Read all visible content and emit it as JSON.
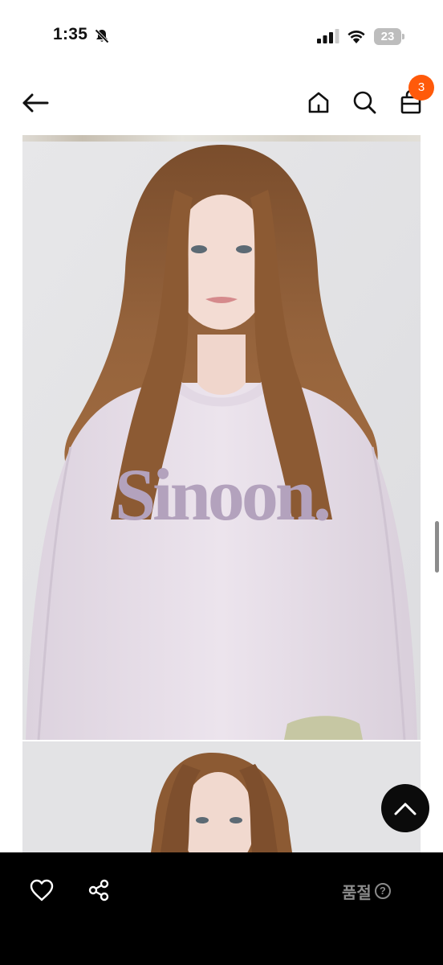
{
  "status_bar": {
    "time": "1:35",
    "battery_level": "23"
  },
  "nav": {
    "cart_count": "3"
  },
  "product": {
    "shirt_logo_text": "Sinoon."
  },
  "bottom_bar": {
    "status_label": "품절",
    "help_symbol": "?"
  },
  "colors": {
    "badge": "#ff5a0a",
    "bottom_bar": "#000000",
    "scroll_top_button": "#0b0b0b",
    "sweatshirt": "#e6dde8",
    "logo": "#b3a2bd",
    "hair": "#8a5a35"
  },
  "icons": [
    "bell-slash-icon",
    "cell-signal-icon",
    "wifi-icon",
    "battery-icon",
    "back-arrow-icon",
    "home-icon",
    "search-icon",
    "cart-icon",
    "chevron-up-icon",
    "heart-icon",
    "share-icon",
    "question-icon"
  ]
}
